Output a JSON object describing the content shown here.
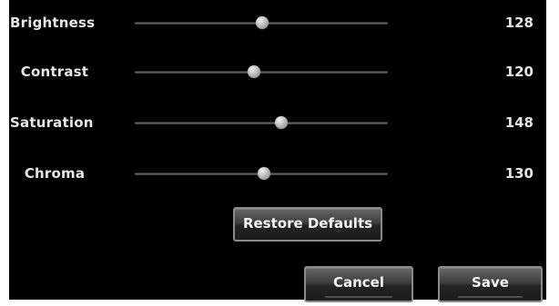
{
  "sliders": [
    {
      "label": "Brightness",
      "value": "128",
      "level": 128
    },
    {
      "label": "Contrast",
      "value": "120",
      "level": 120
    },
    {
      "label": "Saturation",
      "value": "148",
      "level": 148
    },
    {
      "label": "Chroma",
      "value": "130",
      "level": 130
    }
  ],
  "slider_range": {
    "min": 0,
    "max": 255
  },
  "buttons": {
    "restore_defaults": "Restore Defaults",
    "cancel": "Cancel",
    "save": "Save"
  },
  "colors": {
    "panel_bg": "#000000",
    "text": "#e6e6e6"
  }
}
